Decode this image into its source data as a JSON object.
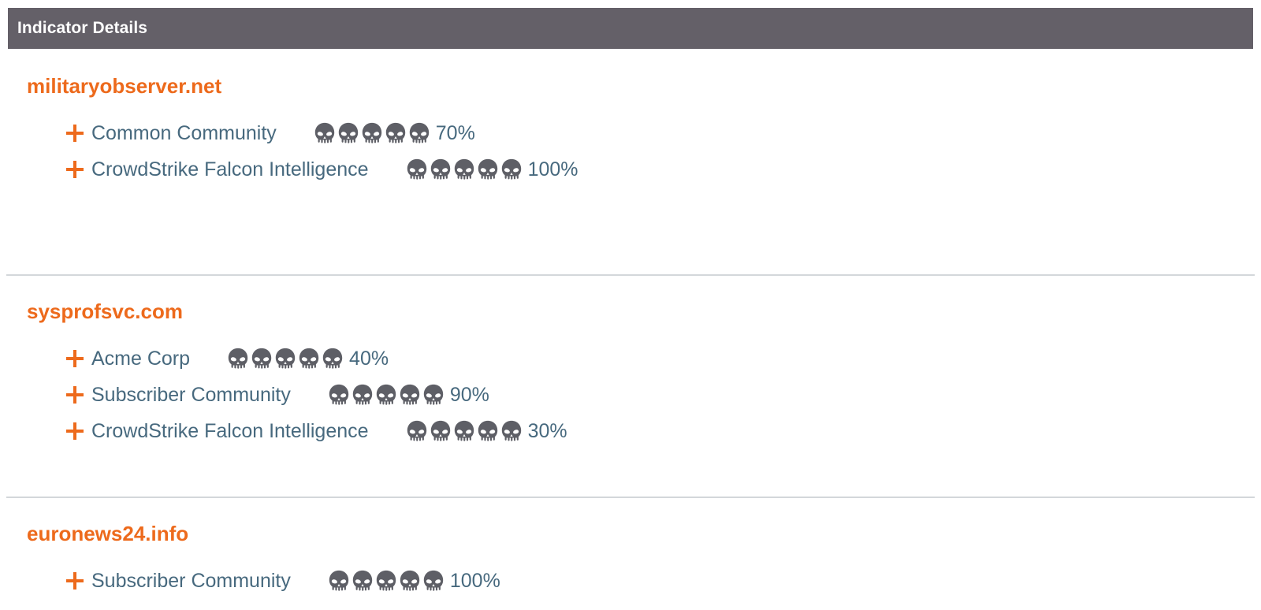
{
  "header": {
    "title": "Indicator Details",
    "background_color": "#646068",
    "text_color": "#ffffff"
  },
  "colors": {
    "indicator_name": "#ED6A1C",
    "expand_icon": "#ED6A1C",
    "source_label": "#47697E",
    "confidence_value": "#47697E",
    "skull": "#5E5F66",
    "divider": "#d3d7da",
    "background": "#ffffff"
  },
  "skull_scale_max": 5,
  "sections": [
    {
      "indicator": "militaryobserver.net",
      "sources": [
        {
          "expand_icon": "plus-icon",
          "label": "Common Community",
          "skulls": 5,
          "confidence": "70%"
        },
        {
          "expand_icon": "plus-icon",
          "label": "CrowdStrike Falcon Intelligence",
          "skulls": 5,
          "confidence": "100%"
        }
      ]
    },
    {
      "indicator": "sysprofsvc.com",
      "sources": [
        {
          "expand_icon": "plus-icon",
          "label": "Acme Corp",
          "skulls": 5,
          "confidence": "40%"
        },
        {
          "expand_icon": "plus-icon",
          "label": "Subscriber Community",
          "skulls": 5,
          "confidence": "90%"
        },
        {
          "expand_icon": "plus-icon",
          "label": "CrowdStrike Falcon Intelligence",
          "skulls": 5,
          "confidence": "30%"
        }
      ]
    },
    {
      "indicator": "euronews24.info",
      "sources": [
        {
          "expand_icon": "plus-icon",
          "label": "Subscriber Community",
          "skulls": 5,
          "confidence": "100%"
        }
      ]
    }
  ]
}
